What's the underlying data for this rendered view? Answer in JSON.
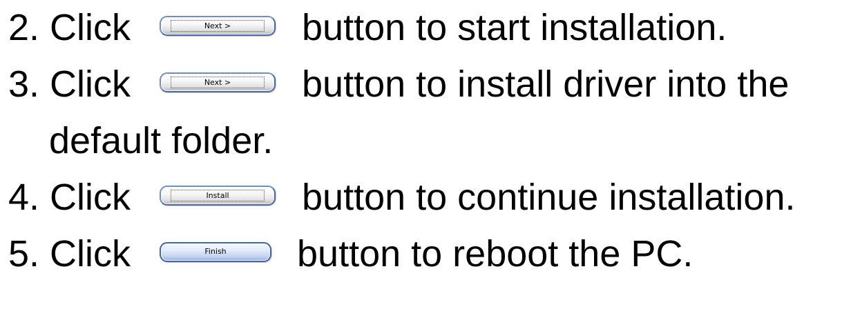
{
  "steps": [
    {
      "number": "2. Click",
      "button_label": "Next >",
      "text": "button to start installation."
    },
    {
      "number": "3. Click",
      "button_label": "Next >",
      "text": "button to install driver into the",
      "continuation": "default folder."
    },
    {
      "number": "4. Click",
      "button_label": "Install",
      "text": "button to continue installation."
    },
    {
      "number": "5. Click",
      "button_label": "Finish",
      "text": "button to reboot the PC."
    }
  ],
  "colors": {
    "text": "#000000",
    "button_border": "#6f8fc2",
    "finish_button": "#98b1de"
  }
}
